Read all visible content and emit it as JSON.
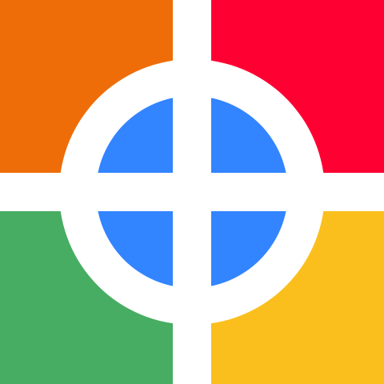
{
  "logo": {
    "icon": "quartered-crosshair-logo",
    "colors": {
      "top_left": "#EE6D08",
      "top_right": "#FF0033",
      "bottom_left": "#47AD62",
      "bottom_right": "#FBBF1D",
      "center": "#3384FF",
      "separator": "#FFFFFF"
    }
  }
}
